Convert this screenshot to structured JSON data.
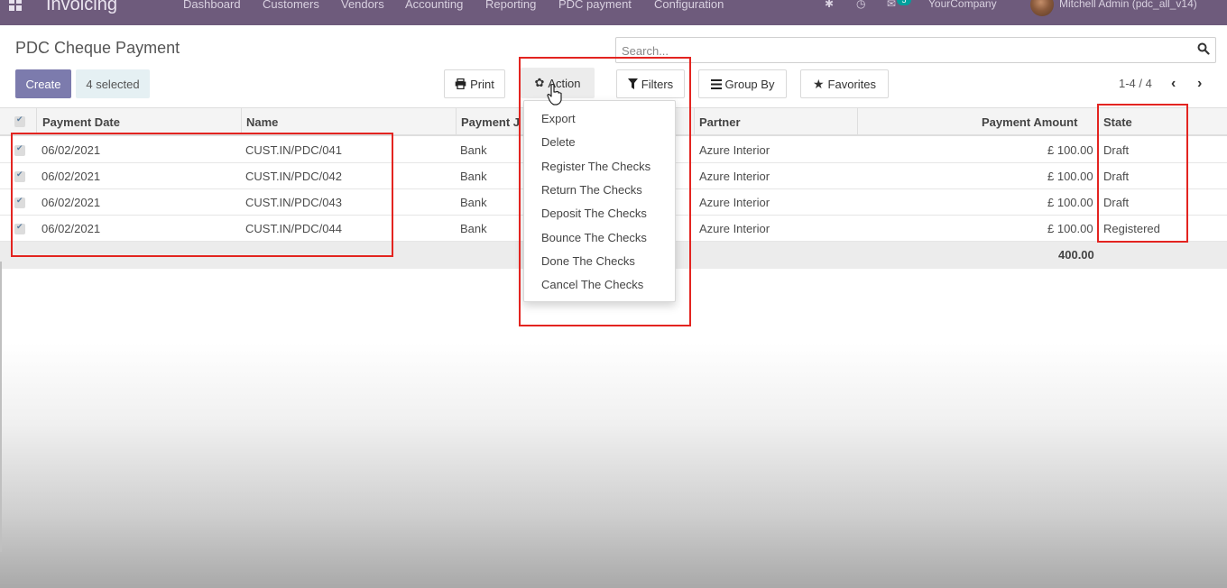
{
  "app": {
    "name": "Invoicing",
    "menu": [
      "Dashboard",
      "Customers",
      "Vendors",
      "Accounting",
      "Reporting",
      "PDC payment",
      "Configuration"
    ],
    "messages_count": "5",
    "company": "YourCompany",
    "user": "Mitchell Admin (pdc_all_v14)"
  },
  "page": {
    "title": "PDC Cheque Payment",
    "search_placeholder": "Search...",
    "create_label": "Create",
    "selected_label": "4 selected",
    "print_label": "Print",
    "action_label": "Action",
    "filters_label": "Filters",
    "groupby_label": "Group By",
    "favorites_label": "Favorites",
    "pager": "1-4 / 4"
  },
  "table": {
    "columns": [
      "Payment Date",
      "Name",
      "Payment J",
      "Partner",
      "Payment Amount",
      "State"
    ],
    "rows": [
      {
        "date": "06/02/2021",
        "name": "CUST.IN/PDC/041",
        "journal": "Bank",
        "partner": "Azure Interior",
        "amount": "£ 100.00",
        "state": "Draft"
      },
      {
        "date": "06/02/2021",
        "name": "CUST.IN/PDC/042",
        "journal": "Bank",
        "partner": "Azure Interior",
        "amount": "£ 100.00",
        "state": "Draft"
      },
      {
        "date": "06/02/2021",
        "name": "CUST.IN/PDC/043",
        "journal": "Bank",
        "partner": "Azure Interior",
        "amount": "£ 100.00",
        "state": "Draft"
      },
      {
        "date": "06/02/2021",
        "name": "CUST.IN/PDC/044",
        "journal": "Bank",
        "partner": "Azure Interior",
        "amount": "£ 100.00",
        "state": "Registered"
      }
    ],
    "total": "400.00"
  },
  "action_menu": [
    "Export",
    "Delete",
    "Register The Checks",
    "Return The Checks",
    "Deposit The Checks",
    "Bounce The Checks",
    "Done The Checks",
    "Cancel The Checks"
  ],
  "colors": {
    "navbar": "#6e5b7c",
    "primary": "#7c7bad",
    "annotation": "#e32420"
  }
}
